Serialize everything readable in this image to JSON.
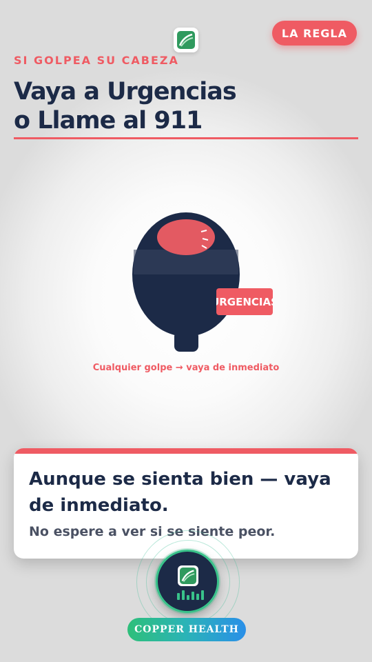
{
  "header": {
    "badge": "LA REGLA",
    "kicker": "SI GOLPEA SU CABEZA",
    "title_line1": "Vaya a Urgencias",
    "title_line2": "o Llame al 911"
  },
  "illustration": {
    "tag": "URGENCIAS",
    "caption": "Cualquier golpe → vaya de inmediato"
  },
  "card": {
    "headline": "Aunque se sienta bien — vaya de inmediato.",
    "subtext": "No espere a ver si se siente peor."
  },
  "brand": {
    "name": "COPPER HEALTH",
    "logo_icon": "copper-health-logo-icon"
  },
  "colors": {
    "accent": "#ef5b63",
    "navy": "#1c2a47",
    "green": "#39c28a"
  }
}
